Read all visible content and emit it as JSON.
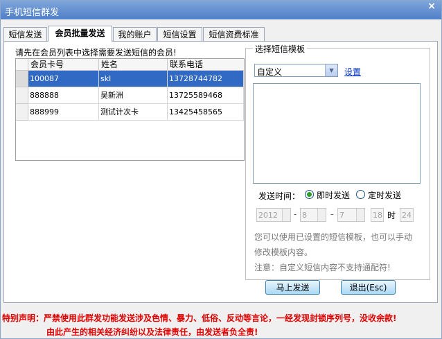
{
  "window": {
    "title": "手机短信群发",
    "close_glyph": "×"
  },
  "tabs": [
    "短信发送",
    "会员批量发送",
    "我的账户",
    "短信设置",
    "短信资费标准"
  ],
  "member": {
    "prompt": "请先在会员列表中选择需要发送短信的会员!",
    "columns": [
      "会员卡号",
      "姓名",
      "联系电话"
    ],
    "rows": [
      [
        "100087",
        "skl",
        "13728744782"
      ],
      [
        "888888",
        "吴新洲",
        "13725589468"
      ],
      [
        "888999",
        "测试计次卡",
        "13425458565"
      ]
    ]
  },
  "template": {
    "legend": "选择短信模板",
    "selected": "自定义",
    "settings_link": "设置",
    "send_time_label": "发送时间：",
    "radio_now": "即时发送",
    "radio_timed": "定时发送",
    "date": {
      "year": "2012",
      "month": "8",
      "day": "7",
      "hour": "18",
      "hour_unit": "时",
      "minute": "24",
      "separator": "-"
    },
    "hint1": "您可以使用已设置的短信模板，也可以手动",
    "hint2": "修改模板内容。",
    "note": "注意：自定义短信内容不支持通配符!"
  },
  "buttons": {
    "send": "马上发送",
    "exit": "退出(Esc)"
  },
  "declaration": {
    "line1": "特别声明：严禁使用此群发功能发送涉及色情、暴力、低俗、反动等言论，一经发现封锁序列号，没收余款!",
    "line2": "由此产生的相关经济纠纷以及法律责任，由发送者负全责!"
  }
}
